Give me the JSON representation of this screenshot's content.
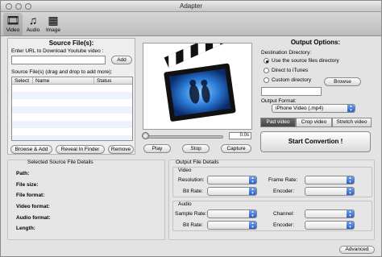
{
  "window": {
    "title": "Adapter"
  },
  "toolbar": {
    "video": "Video",
    "audio": "Audio",
    "image": "Image"
  },
  "source": {
    "title": "Source File(s):",
    "url_label": "Enter URL to Download Youtube video :",
    "url_value": "",
    "add": "Add",
    "files_label": "Source File(s) (drag and drop to add more):",
    "columns": [
      "Select",
      "Name",
      "Status"
    ],
    "browse_add": "Browse & Add",
    "reveal": "Reveal In Finder",
    "remove": "Remove"
  },
  "preview": {
    "time": "0.0s",
    "play": "Play",
    "stop": "Stop",
    "capture": "Capture",
    "position": 0
  },
  "output": {
    "title": "Output Options:",
    "dest_label": "Destination Directory:",
    "options": [
      "Use the source files directory",
      "Direct to iTunes",
      "Custom directory"
    ],
    "selected_option": 0,
    "browse": "Browse",
    "format_label": "Output Format:",
    "format_value": "iPhone Video (.mp4)",
    "pad_video": "Pad video",
    "crop_video": "Crop video",
    "stretch_video": "Stretch video",
    "start": "Start Convertion !"
  },
  "details": {
    "title": "Selected Source File Details",
    "fields": [
      "Path:",
      "File size:",
      "File format:",
      "Video format:",
      "Audio format:",
      "Length:"
    ]
  },
  "output_details": {
    "title": "Output File Details",
    "video_group": "Video",
    "audio_group": "Audio",
    "resolution": "Resolution:",
    "frame_rate": "Frame Rate:",
    "bit_rate": "Bit Rate:",
    "encoder": "Encoder:",
    "sample_rate": "Sample Rate:",
    "channel": "Channel:",
    "audio_bit_rate": "Bit Rate:",
    "audio_encoder": "Encoder:"
  },
  "footer": {
    "advanced": "Advanced"
  },
  "colors": {
    "accent": "#2d5fc4",
    "selected_segment": "#4f4f4f"
  }
}
